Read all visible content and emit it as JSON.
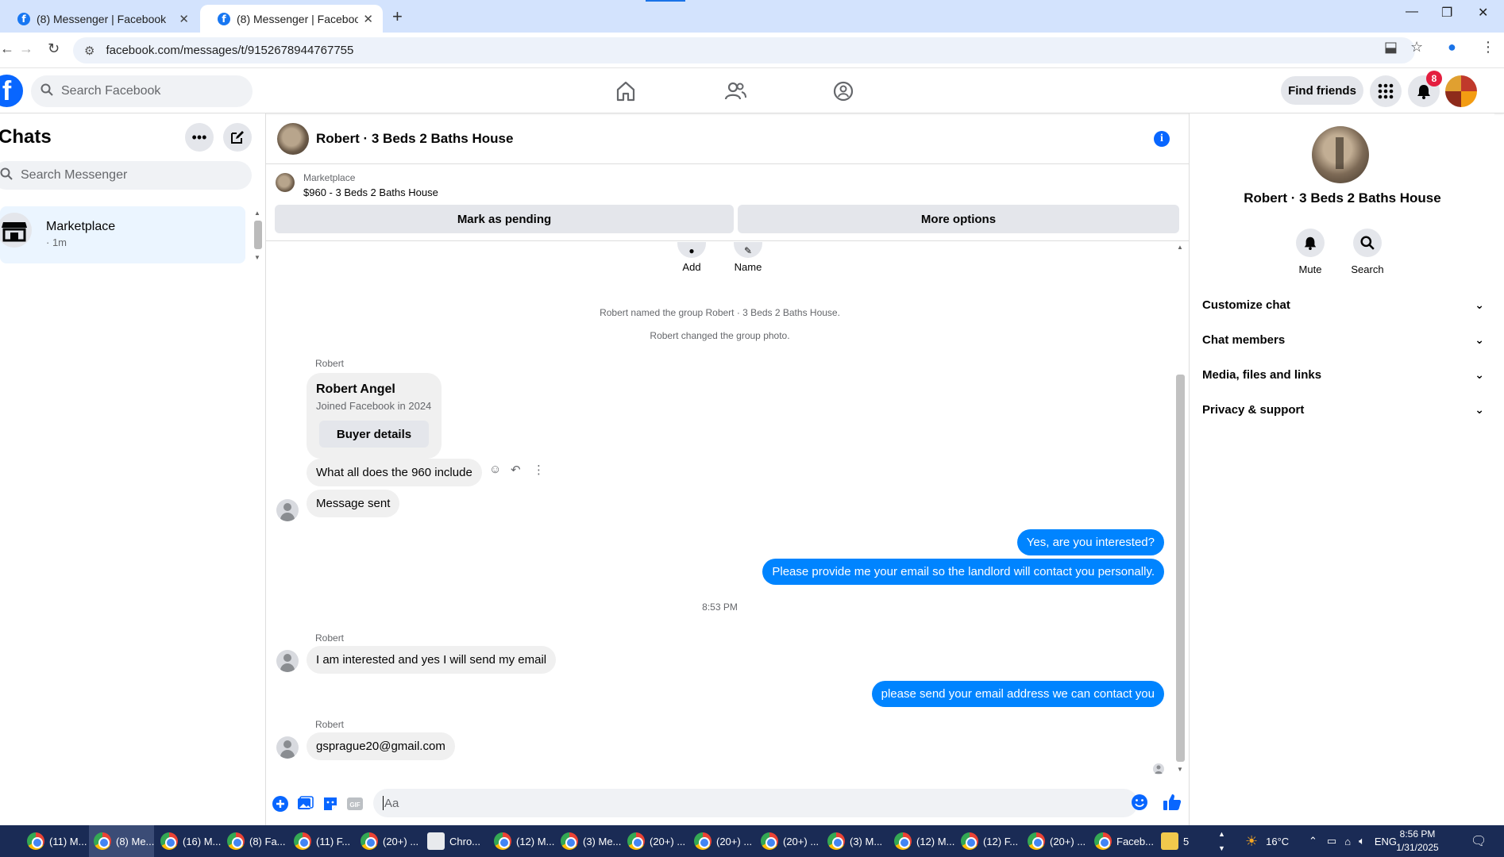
{
  "browser": {
    "tabs": [
      {
        "title": "(8) Messenger | Facebook",
        "active": false
      },
      {
        "title": "(8) Messenger | Facebook",
        "active": true
      }
    ],
    "url": "facebook.com/messages/t/9152678944767755"
  },
  "fb_header": {
    "search_placeholder": "Search Facebook",
    "find_friends": "Find friends",
    "notification_count": "8"
  },
  "chats": {
    "title": "Chats",
    "search_placeholder": "Search Messenger",
    "items": [
      {
        "name": "Marketplace",
        "time": "· 1m"
      }
    ]
  },
  "conversation": {
    "title": "Robert · 3 Beds 2 Baths House",
    "marketplace_label": "Marketplace",
    "listing": "$960 - 3 Beds 2 Baths House",
    "mark_pending": "Mark as pending",
    "more_options": "More options",
    "member_actions": {
      "add": "Add",
      "name": "Name"
    },
    "system_messages": [
      "Robert named the group Robert · 3 Beds 2 Baths House.",
      "Robert changed the group photo."
    ],
    "sender_name": "Robert",
    "buyer_card": {
      "name": "Robert Angel",
      "joined": "Joined Facebook in 2024",
      "button": "Buyer details"
    },
    "messages": {
      "in_1": "What all does the 960 include",
      "in_2": "Message sent",
      "out_1": "Yes, are you interested?",
      "out_2": "Please provide me your email so the landlord will contact you personally.",
      "timestamp": "8:53 PM",
      "in_3": "I am interested and yes I will send my email",
      "out_3": "please send your email address we can contact you",
      "in_4": "gsprague20@gmail.com"
    },
    "composer_placeholder": "Aa"
  },
  "info_panel": {
    "name": "Robert · 3 Beds 2 Baths House",
    "mute": "Mute",
    "search": "Search",
    "sections": [
      "Customize chat",
      "Chat members",
      "Media, files and links",
      "Privacy & support"
    ]
  },
  "taskbar": {
    "items": [
      "(11) M...",
      "(8) Me...",
      "(16) M...",
      "(8) Fa...",
      "(11) F...",
      "(20+) ...",
      "Chro...",
      "(12) M...",
      "(3) Me...",
      "(20+) ...",
      "(20+) ...",
      "(20+) ...",
      "(3) M...",
      "(12) M...",
      "(12) F...",
      "(20+) ...",
      "Faceb...",
      "5"
    ],
    "temperature": "16°C",
    "language": "ENG",
    "time": "8:56 PM",
    "date": "1/31/2025"
  },
  "colors": {
    "fb_blue": "#0866ff",
    "outgoing_bubble": "#0084ff",
    "incoming_bubble": "#f0f0f0",
    "taskbar": "#1a2b55"
  }
}
